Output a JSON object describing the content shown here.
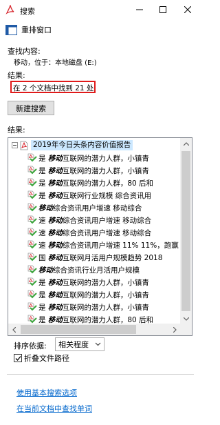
{
  "window": {
    "title": "搜索",
    "controls": {
      "minimize": "—",
      "maximize": "☐",
      "close": "✕"
    }
  },
  "toolbar": {
    "rearrange_label": "重排窗口"
  },
  "query": {
    "label": "查找内容:",
    "value": "移动，位于：本地磁盘 (E:)"
  },
  "results": {
    "label": "结果:",
    "summary": "在 2 个文档中找到 21 处"
  },
  "new_search_label": "新建搜索",
  "results_heading": "结果:",
  "tree": {
    "root": {
      "label": "2019年今日头条内容价值报告",
      "expanded": true,
      "icon": "pdf-document-icon"
    },
    "hits": [
      {
        "pre": "是 ",
        "kw": "移动",
        "post": "互联网的潜力人群，小镇青"
      },
      {
        "pre": "是 ",
        "kw": "移动",
        "post": "互联网的潜力人群，小镇青"
      },
      {
        "pre": "是 ",
        "kw": "移动",
        "post": "互联网的潜力人群，80 后和"
      },
      {
        "pre": "是 ",
        "kw": "移动",
        "post": "互联网行业规模 综合资讯用"
      },
      {
        "pre": "",
        "kw": "移动",
        "post": "综合资讯用户增速 移动综合"
      },
      {
        "pre": "速 ",
        "kw": "移动",
        "post": "综合资讯用户增速 移动综合"
      },
      {
        "pre": "速 ",
        "kw": "移动",
        "post": "综合资讯用户增速 移动综合"
      },
      {
        "pre": "速 ",
        "kw": "移动",
        "post": "综合资讯用户增速 11% 11%，跑赢"
      },
      {
        "pre": "国 ",
        "kw": "移动",
        "post": "互联网月活用户规模趋势 2018"
      },
      {
        "pre": "",
        "kw": "移动",
        "post": "综合资讯行业月活用户规模"
      },
      {
        "pre": "是 ",
        "kw": "移动",
        "post": "互联网的潜力人群，小镇青"
      },
      {
        "pre": "是 ",
        "kw": "移动",
        "post": "互联网的潜力人群，小镇青"
      },
      {
        "pre": "是 ",
        "kw": "移动",
        "post": "互联网的潜力人群，小镇青"
      },
      {
        "pre": "是 ",
        "kw": "移动",
        "post": "互联网的潜力人群，80 后和"
      }
    ]
  },
  "sort": {
    "label": "排序依据:",
    "selected": "相关程度"
  },
  "collapse_paths": {
    "label": "折叠文件路径",
    "checked": true
  },
  "links": {
    "basic_search": "使用基本搜索选项",
    "find_in_current": "在当前文档中查找单词"
  },
  "colors": {
    "accent_red": "#e01a1a",
    "link": "#0066cc",
    "selection": "#cce8ff",
    "hit_icon_green": "#3aa53a"
  }
}
